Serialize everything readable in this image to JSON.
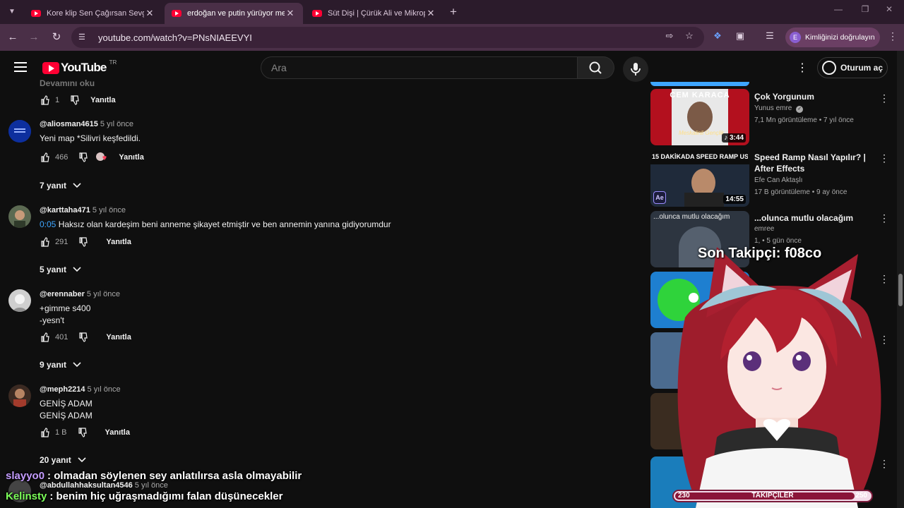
{
  "browser": {
    "tabs": [
      {
        "title": "Kore klip Sen Çağırsan Sevgilim",
        "active": false
      },
      {
        "title": "erdoğan ve putin yürüyor mem",
        "active": true
      },
      {
        "title": "Süt Dişi | Çürük Ali ve Mikrop Ne",
        "active": false
      }
    ],
    "url": "youtube.com/watch?v=PNsNIAEEVYI",
    "identity_label": "Kimliğinizi doğrulayın",
    "identity_initial": "E"
  },
  "youtube": {
    "logo_text": "YouTube",
    "country_code": "TR",
    "search_placeholder": "Ara",
    "signin_label": "Oturum aç"
  },
  "comments": {
    "cut_text": "Devamını oku",
    "first_actions": {
      "likes": "1",
      "reply": "Yanıtla"
    },
    "items": [
      {
        "user": "@aliosman4615",
        "time": "5 yıl önce",
        "lines": [
          "Yeni map *Silivri keşfedildi."
        ],
        "likes": "466",
        "reply": "Yanıtla",
        "replies": "7 yanıt"
      },
      {
        "user": "@karttaha471",
        "time": "5 yıl önce",
        "timestamp": "0:05",
        "lines": [
          "Haksız olan kardeşim beni anneme şikayet etmiştir ve ben annemin yanına gidiyorumdur"
        ],
        "likes": "291",
        "reply": "Yanıtla",
        "replies": "5 yanıt"
      },
      {
        "user": "@erennaber",
        "time": "5 yıl önce",
        "lines": [
          "+gimme s400",
          "-yesn't"
        ],
        "likes": "401",
        "reply": "Yanıtla",
        "replies": "9 yanıt"
      },
      {
        "user": "@meph2214",
        "time": "5 yıl önce",
        "lines": [
          "GENİŞ ADAM",
          "GENİŞ ADAM"
        ],
        "likes": "1 B",
        "reply": "Yanıtla",
        "replies": "20 yanıt"
      },
      {
        "user": "@abdullahhaksultan4546",
        "time": "5 yıl önce"
      }
    ]
  },
  "sidebar": {
    "items": [
      {
        "title": "Çok Yorgunum",
        "channel": "Yunus emre",
        "verified": true,
        "views": "7,1 Mn görüntüleme",
        "age": "7 yıl önce",
        "duration": "3:44",
        "thumb_text": "CEM KARACA",
        "thumb_sub": "Meskalinli Gençlik"
      },
      {
        "title": "Speed Ramp Nasıl Yapılır? | After Effects",
        "channel": "Efe Can Aktaşlı",
        "views": "17 B görüntüleme",
        "age": "9 ay önce",
        "duration": "14:55",
        "thumb_text": "15 DAKİKADA SPEED RAMP USTASI OL!",
        "badge": "Ae"
      },
      {
        "title": "...olunca mutlu olacağım",
        "channel": "emree",
        "views": "1,",
        "age": "5 gün önce",
        "thumb_text": "...olunca mutlu olacağım"
      }
    ]
  },
  "overlay": {
    "follower_banner": "Son Takipçi: f08co",
    "follow_goal": {
      "label": "TAKİPÇİLER",
      "current": "230",
      "goal": "250",
      "progress": 0.92
    },
    "chat": [
      {
        "user": "slayyo0",
        "user_color": "#c49cff",
        "message": ": olmadan söylenen sey anlatılırsa asla olmayabilir"
      },
      {
        "user": "Kelinsty",
        "user_color": "#7cff5a",
        "message": ": benim hiç uğraşmadığımı falan düşünecekler"
      }
    ]
  }
}
